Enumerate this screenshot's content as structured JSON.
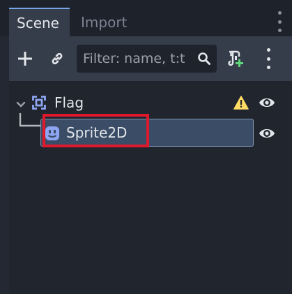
{
  "tabs": [
    {
      "label": "Scene",
      "active": true
    },
    {
      "label": "Import",
      "active": false
    }
  ],
  "toolbar": {
    "add_icon": "plus-icon",
    "link_icon": "link-icon",
    "filter_placeholder": "Filter: name, t:type, g:group",
    "filter_display": "Filter: name, t:t",
    "search_icon": "search-icon",
    "script_icon": "attach-script-icon",
    "menu_icon": "kebab-menu-icon"
  },
  "tree": {
    "nodes": [
      {
        "label": "Flag",
        "icon": "node2d-icon",
        "expanded": true,
        "warning": true,
        "visible": true
      },
      {
        "label": "Sprite2D",
        "icon": "sprite2d-icon",
        "selected": true,
        "visible": true
      }
    ]
  },
  "colors": {
    "accent": "#75a4e9",
    "node2d": "#8da5f3",
    "warning": "#ffdd65",
    "selection": "#3b4d66",
    "highlight_outline": "#e0182c"
  }
}
